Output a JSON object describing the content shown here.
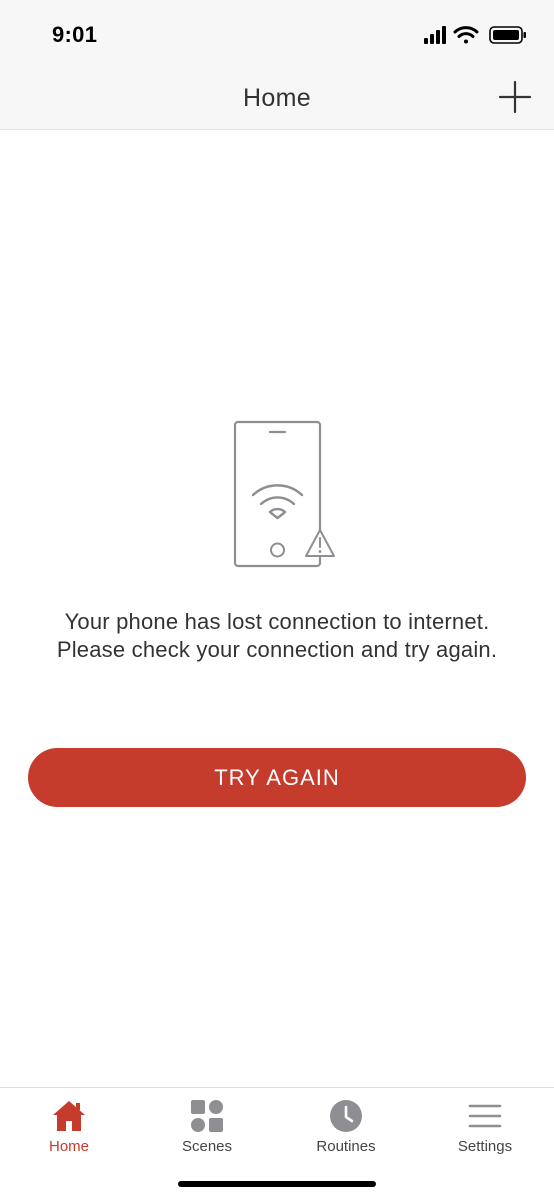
{
  "status_bar": {
    "time": "9:01",
    "icons": [
      "cellular-signal-icon",
      "wifi-icon",
      "battery-icon"
    ]
  },
  "header": {
    "title": "Home",
    "add_icon": "plus-icon"
  },
  "main": {
    "illustration": "phone-no-connection-icon",
    "message": "Your phone has lost connection to internet. Please check your connection and try again.",
    "button_label": "TRY AGAIN"
  },
  "tabs": [
    {
      "label": "Home",
      "icon": "home-icon",
      "active": true
    },
    {
      "label": "Scenes",
      "icon": "scenes-grid-icon",
      "active": false
    },
    {
      "label": "Routines",
      "icon": "clock-icon",
      "active": false
    },
    {
      "label": "Settings",
      "icon": "menu-lines-icon",
      "active": false
    }
  ],
  "colors": {
    "accent": "#c53b2c",
    "header_bg": "#f7f7f7",
    "icon_gray": "#8e8e93",
    "text": "#333333"
  }
}
